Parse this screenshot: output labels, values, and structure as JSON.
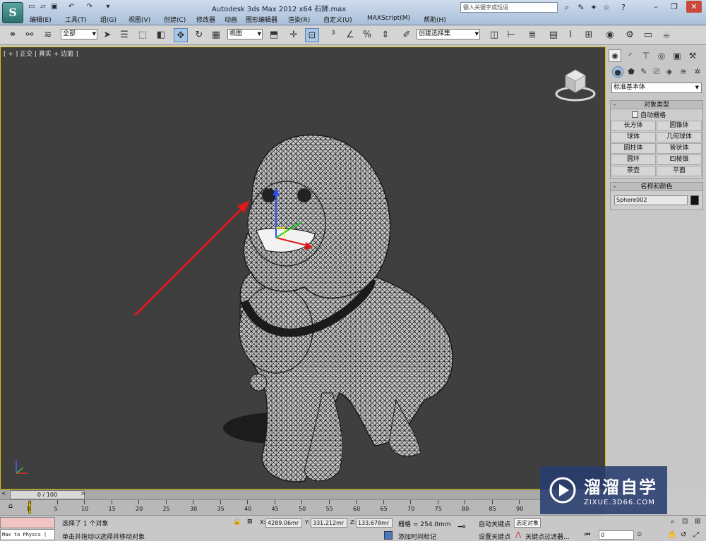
{
  "titlebar": {
    "title": "Autodesk 3ds Max  2012 x64      石狮.max",
    "search_placeholder": "键入关键字或短语",
    "logo_letter": "S"
  },
  "menu": [
    "编辑(E)",
    "工具(T)",
    "组(G)",
    "视图(V)",
    "创建(C)",
    "修改器",
    "动画",
    "图形编辑器",
    "渲染(R)",
    "自定义(U)",
    "MAXScript(M)",
    "帮助(H)"
  ],
  "toolbar": {
    "selection_filter": "全部",
    "reference_coord": "视图",
    "named_selection": "创建选择集"
  },
  "viewport": {
    "label": "[ + ] 正交 | 真实 + 边面 ]"
  },
  "command_panel": {
    "category": "标准基本体",
    "object_type": {
      "title": "对象类型",
      "autogrid": "自动栅格",
      "buttons": [
        "长方体",
        "圆锥体",
        "球体",
        "几何球体",
        "圆柱体",
        "管状体",
        "圆环",
        "四棱锥",
        "茶壶",
        "平面"
      ]
    },
    "name_color": {
      "title": "名称和颜色",
      "name": "Sphere002",
      "swatch_color": "#111111"
    }
  },
  "timeline": {
    "frame": "0 / 100",
    "ticks": [
      "0",
      "5",
      "10",
      "15",
      "20",
      "25",
      "30",
      "35",
      "40",
      "45",
      "50",
      "55",
      "60",
      "65",
      "70",
      "75",
      "80",
      "85",
      "90"
    ]
  },
  "status": {
    "script_text": "Max to Physcs (",
    "selection": "选择了 1 个对象",
    "prompt": "单击并拖动以选择并移动对象",
    "x_label": "X:",
    "x_value": "4289.06mr",
    "y_label": "Y:",
    "y_value": "331.212mr",
    "z_label": "Z:",
    "z_value": "133.678mr",
    "grid": "栅格 = 254.0mm",
    "add_time_tag": "添加时间标记",
    "auto_key": "自动关键点",
    "set_key": "设置关键点",
    "selected_object": "选定对象",
    "key_filters": "关键点过滤器...",
    "frame_field": "0"
  },
  "watermark": {
    "title": "溜溜自学",
    "subtitle": "ZIXUE.3D66.COM"
  },
  "colors": {
    "viewport_bg": "#3f3f3f",
    "active_border": "#e0c000",
    "arrow": "#e01818",
    "watermark_bg": "#283c6e"
  }
}
